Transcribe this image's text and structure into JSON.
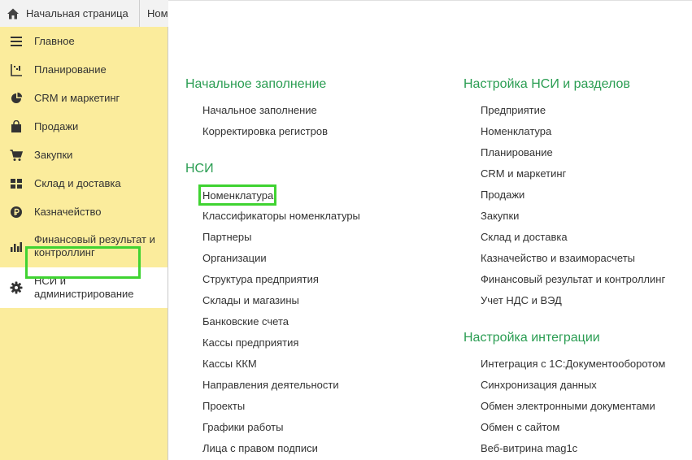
{
  "tabs": [
    {
      "label": "Начальная страница",
      "icon": "home-icon"
    },
    {
      "label": "Номенклатура"
    }
  ],
  "sidebar": {
    "items": [
      {
        "label": "Главное",
        "icon": "menu-lines-icon"
      },
      {
        "label": "Планирование",
        "icon": "planning-icon"
      },
      {
        "label": "CRM и маркетинг",
        "icon": "pie-chart-icon"
      },
      {
        "label": "Продажи",
        "icon": "shopping-bag-icon"
      },
      {
        "label": "Закупки",
        "icon": "cart-icon"
      },
      {
        "label": "Склад и доставка",
        "icon": "grid-icon"
      },
      {
        "label": "Казначейство",
        "icon": "ruble-icon"
      },
      {
        "label": "Финансовый результат и контроллинг",
        "icon": "bar-chart-icon"
      },
      {
        "label": "НСИ и администрирование",
        "icon": "gear-icon"
      }
    ]
  },
  "left_column": {
    "sections": [
      {
        "title": "Начальное заполнение",
        "links": [
          "Начальное заполнение",
          "Корректировка регистров"
        ]
      },
      {
        "title": "НСИ",
        "links": [
          "Номенклатура",
          "Классификаторы номенклатуры",
          "Партнеры",
          "Организации",
          "Структура предприятия",
          "Склады и магазины",
          "Банковские счета",
          "Кассы предприятия",
          "Кассы ККМ",
          "Направления деятельности",
          "Проекты",
          "Графики работы",
          "Лица с правом подписи"
        ]
      }
    ]
  },
  "right_column": {
    "sections": [
      {
        "title": "Настройка НСИ и разделов",
        "links": [
          "Предприятие",
          "Номенклатура",
          "Планирование",
          "CRM и маркетинг",
          "Продажи",
          "Закупки",
          "Склад и доставка",
          "Казначейство и взаиморасчеты",
          "Финансовый результат и контроллинг",
          "Учет НДС и ВЭД"
        ]
      },
      {
        "title": "Настройка интеграции",
        "links": [
          "Интеграция с 1С:Документооборотом",
          "Синхронизация данных",
          "Обмен электронными документами",
          "Обмен с сайтом",
          "Веб-витрина mag1c"
        ]
      }
    ]
  },
  "colors": {
    "sidebar_bg": "#fbec9c",
    "section_title": "#2a9d52",
    "highlight": "#3fd331"
  }
}
